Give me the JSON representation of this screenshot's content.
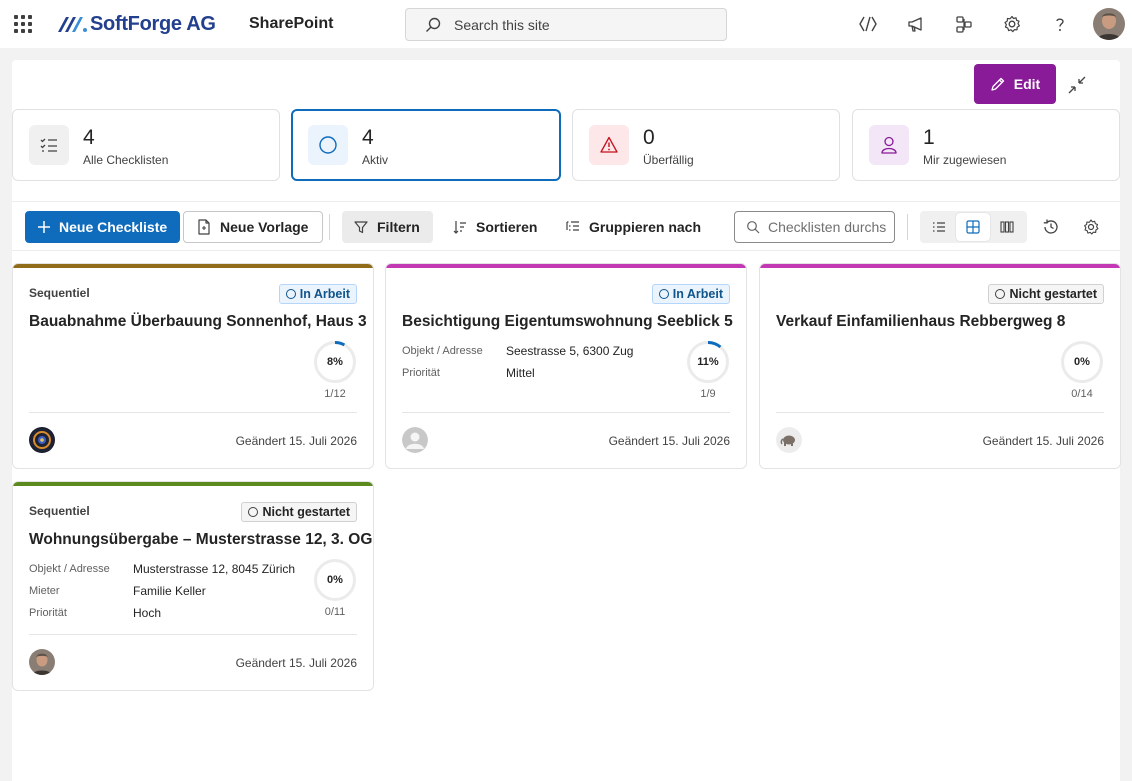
{
  "header": {
    "brand": "SoftForge AG",
    "app": "SharePoint",
    "search_placeholder": "Search this site"
  },
  "commandbar": {
    "edit_label": "Edit"
  },
  "stats": [
    {
      "value": "4",
      "label": "Alle Checklisten"
    },
    {
      "value": "4",
      "label": "Aktiv"
    },
    {
      "value": "0",
      "label": "Überfällig"
    },
    {
      "value": "1",
      "label": "Mir zugewiesen"
    }
  ],
  "toolbar": {
    "new_checklist": "Neue Checkliste",
    "new_template": "Neue Vorlage",
    "filter": "Filtern",
    "sort": "Sortieren",
    "group": "Gruppieren nach",
    "search_placeholder": "Checklisten durchs"
  },
  "cards": [
    {
      "type": "Sequentiel",
      "status": "In Arbeit",
      "title": "Bauabnahme Überbauung Sonnenhof, Haus 3",
      "progress_pct": "8%",
      "progress_value": 0.08,
      "count": "1/12",
      "changed": "Geändert 15. Juli 2026",
      "stripe_color": "#8f6b1a",
      "fields": []
    },
    {
      "type": "",
      "status": "In Arbeit",
      "title": "Besichtigung Eigentumswohnung Seeblick 5",
      "progress_pct": "11%",
      "progress_value": 0.11,
      "count": "1/9",
      "changed": "Geändert 15. Juli 2026",
      "stripe_color": "#c239b3",
      "fields": [
        {
          "label": "Objekt / Adresse",
          "value": "Seestrasse 5, 6300 Zug"
        },
        {
          "label": "Priorität",
          "value": "Mittel"
        }
      ]
    },
    {
      "type": "",
      "status": "Nicht gestartet",
      "title": "Verkauf Einfamilienhaus Rebbergweg 8",
      "progress_pct": "0%",
      "progress_value": 0,
      "count": "0/14",
      "changed": "Geändert 15. Juli 2026",
      "stripe_color": "#c239b3",
      "fields": []
    },
    {
      "type": "Sequentiel",
      "status": "Nicht gestartet",
      "title": "Wohnungsübergabe – Musterstrasse 12, 3. OG",
      "progress_pct": "0%",
      "progress_value": 0,
      "count": "0/11",
      "changed": "Geändert 15. Juli 2026",
      "stripe_color": "#5c8a1f",
      "fields": [
        {
          "label": "Objekt / Adresse",
          "value": "Musterstrasse 12, 8045 Zürich"
        },
        {
          "label": "Mieter",
          "value": "Familie Keller"
        },
        {
          "label": "Priorität",
          "value": "Hoch"
        }
      ]
    }
  ],
  "colors": {
    "accent": "#0f6cbd",
    "edit": "#8a1b98",
    "progress": "#0f6cbd"
  }
}
